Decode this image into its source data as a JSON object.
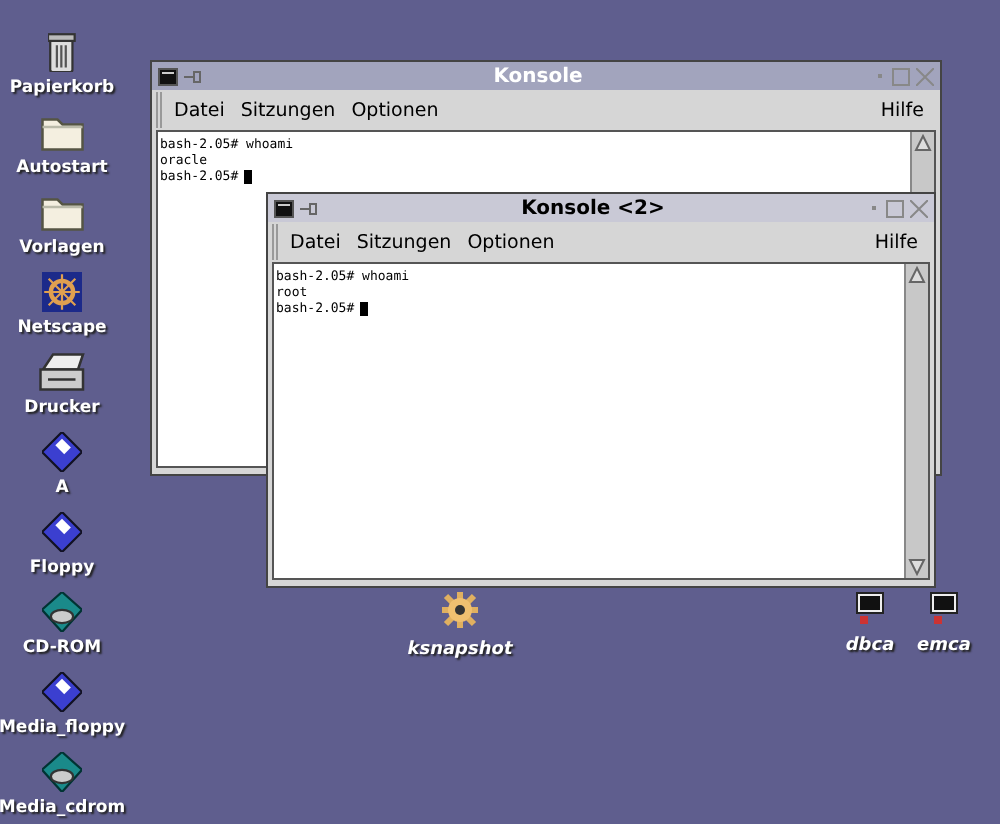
{
  "desktop_icons": [
    {
      "label": "Papierkorb",
      "kind": "trash",
      "link": false
    },
    {
      "label": "Autostart",
      "kind": "folder",
      "link": false
    },
    {
      "label": "Vorlagen",
      "kind": "folder",
      "link": false
    },
    {
      "label": "Netscape",
      "kind": "browser",
      "link": false
    },
    {
      "label": "Drucker",
      "kind": "printer",
      "link": false
    },
    {
      "label": "A",
      "kind": "floppy",
      "link": false
    },
    {
      "label": "Floppy",
      "kind": "floppy",
      "link": false
    },
    {
      "label": "CD-ROM",
      "kind": "cdrom",
      "link": false
    },
    {
      "label": "Media_floppy",
      "kind": "floppy",
      "link": false
    },
    {
      "label": "Media_cdrom",
      "kind": "cdrom",
      "link": false
    }
  ],
  "free_icons": [
    {
      "label": "ksnapshot",
      "kind": "camera",
      "link": true
    },
    {
      "label": "dbca",
      "kind": "terminal",
      "link": true
    },
    {
      "label": "emca",
      "kind": "terminal",
      "link": true
    }
  ],
  "windows": [
    {
      "title": "Konsole",
      "active": false,
      "menu": [
        "Datei",
        "Sitzungen",
        "Optionen"
      ],
      "help": "Hilfe",
      "lines": [
        "bash-2.05# whoami",
        "oracle",
        "bash-2.05#"
      ]
    },
    {
      "title": "Konsole <2>",
      "active": true,
      "menu": [
        "Datei",
        "Sitzungen",
        "Optionen"
      ],
      "help": "Hilfe",
      "lines": [
        "bash-2.05# whoami",
        "root",
        "bash-2.05#"
      ]
    }
  ]
}
